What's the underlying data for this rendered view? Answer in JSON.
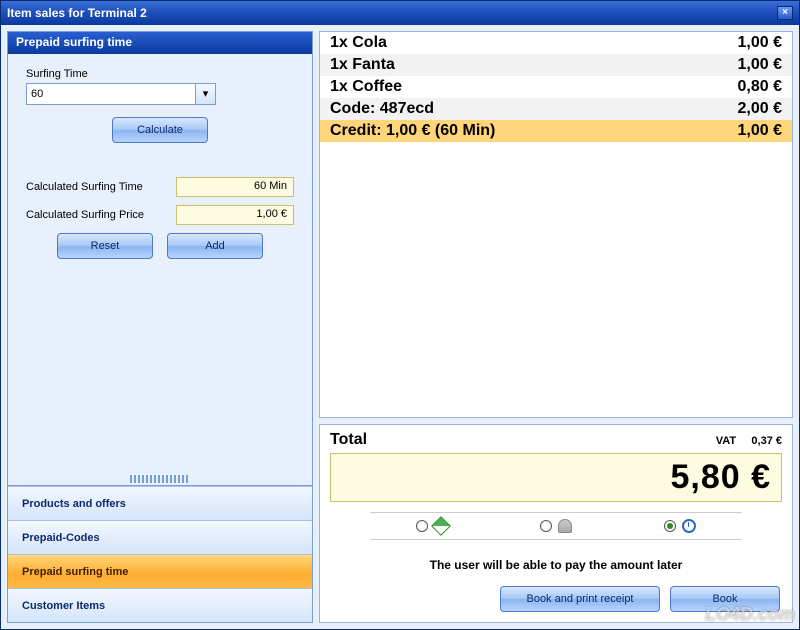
{
  "window": {
    "title": "Item sales for Terminal 2"
  },
  "panel": {
    "title": "Prepaid surfing time",
    "surfing_label": "Surfing Time",
    "surfing_value": "60",
    "calculate": "Calculate",
    "calc_time_label": "Calculated Surfing Time",
    "calc_time_value": "60 Min",
    "calc_price_label": "Calculated Surfing Price",
    "calc_price_value": "1,00 €",
    "reset": "Reset",
    "add": "Add"
  },
  "accordion": {
    "products": "Products and offers",
    "codes": "Prepaid-Codes",
    "surfing": "Prepaid surfing time",
    "customer": "Customer Items"
  },
  "items": [
    {
      "label": "1x Cola",
      "price": "1,00 €",
      "cls": ""
    },
    {
      "label": "1x Fanta",
      "price": "1,00 €",
      "cls": "alt"
    },
    {
      "label": "1x Coffee",
      "price": "0,80 €",
      "cls": ""
    },
    {
      "label": "Code: 487ecd",
      "price": "2,00 €",
      "cls": "alt"
    },
    {
      "label": "Credit: 1,00 € (60 Min)",
      "price": "1,00 €",
      "cls": "credit"
    }
  ],
  "total": {
    "label": "Total",
    "vat_label": "VAT",
    "vat_value": "0,37 €",
    "amount": "5,80 €"
  },
  "pay": {
    "msg": "The user will be able to pay the amount later",
    "book_print": "Book and print receipt",
    "book": "Book",
    "selected": 2
  },
  "watermark": "LO4D.com"
}
